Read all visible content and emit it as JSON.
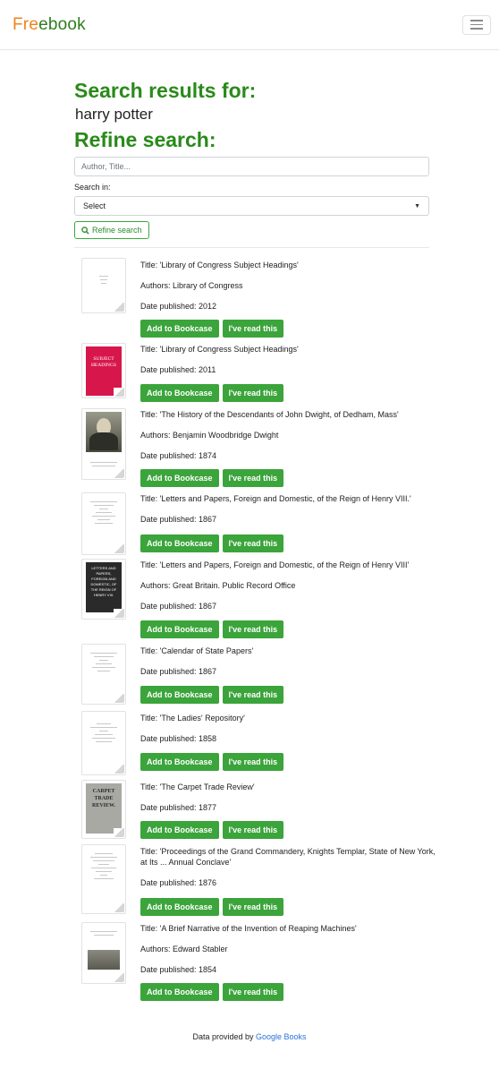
{
  "brand": {
    "part1": "Fre",
    "part2": "ebook"
  },
  "header": {
    "menu_icon": "hamburger-icon"
  },
  "search": {
    "results_heading": "Search results for:",
    "query": "harry potter",
    "refine_heading": "Refine search:",
    "input_placeholder": "Author, Title...",
    "search_in_label": "Search in:",
    "select_value": "Select",
    "refine_button": "Refine search"
  },
  "buttons": {
    "bookcase": "Add to Bookcase",
    "read": "I've read this"
  },
  "results": [
    {
      "title": "Title: 'Library of Congress Subject Headings'",
      "authors": "Authors: Library of Congress",
      "date": "Date published: 2012"
    },
    {
      "title": "Title: 'Library of Congress Subject Headings'",
      "authors": "",
      "date": "Date published: 2011"
    },
    {
      "title": "Title: 'The History of the Descendants of John Dwight, of Dedham, Mass'",
      "authors": "Authors: Benjamin Woodbridge Dwight",
      "date": "Date published: 1874"
    },
    {
      "title": "Title: 'Letters and Papers, Foreign and Domestic, of the Reign of Henry VIII.'",
      "authors": "",
      "date": "Date published: 1867"
    },
    {
      "title": "Title: 'Letters and Papers, Foreign and Domestic, of the Reign of Henry VIII'",
      "authors": "Authors: Great Britain. Public Record Office",
      "date": "Date published: 1867"
    },
    {
      "title": "Title: 'Calendar of State Papers'",
      "authors": "",
      "date": "Date published: 1867"
    },
    {
      "title": "Title: 'The Ladies' Repository'",
      "authors": "",
      "date": "Date published: 1858"
    },
    {
      "title": "Title: 'The Carpet Trade Review'",
      "authors": "",
      "date": "Date published: 1877"
    },
    {
      "title": "Title: 'Proceedings of the Grand Commandery, Knights Templar, State of New York, at Its ... Annual Conclave'",
      "authors": "",
      "date": "Date published: 1876"
    },
    {
      "title": "Title: 'A Brief Narrative of the Invention of Reaping Machines'",
      "authors": "Authors: Edward Stabler",
      "date": "Date published: 1854"
    }
  ],
  "covers": {
    "subject": "SUBJECT HEADINGS",
    "letters": "LETTERS AND PAPERS, FOREIGN AND DOMESTIC, OF THE REIGN OF HENRY VIII.",
    "carpet": "CARPET TRADE REVIEW."
  },
  "footer": {
    "prefix": "Data provided by ",
    "link": "Google Books"
  }
}
